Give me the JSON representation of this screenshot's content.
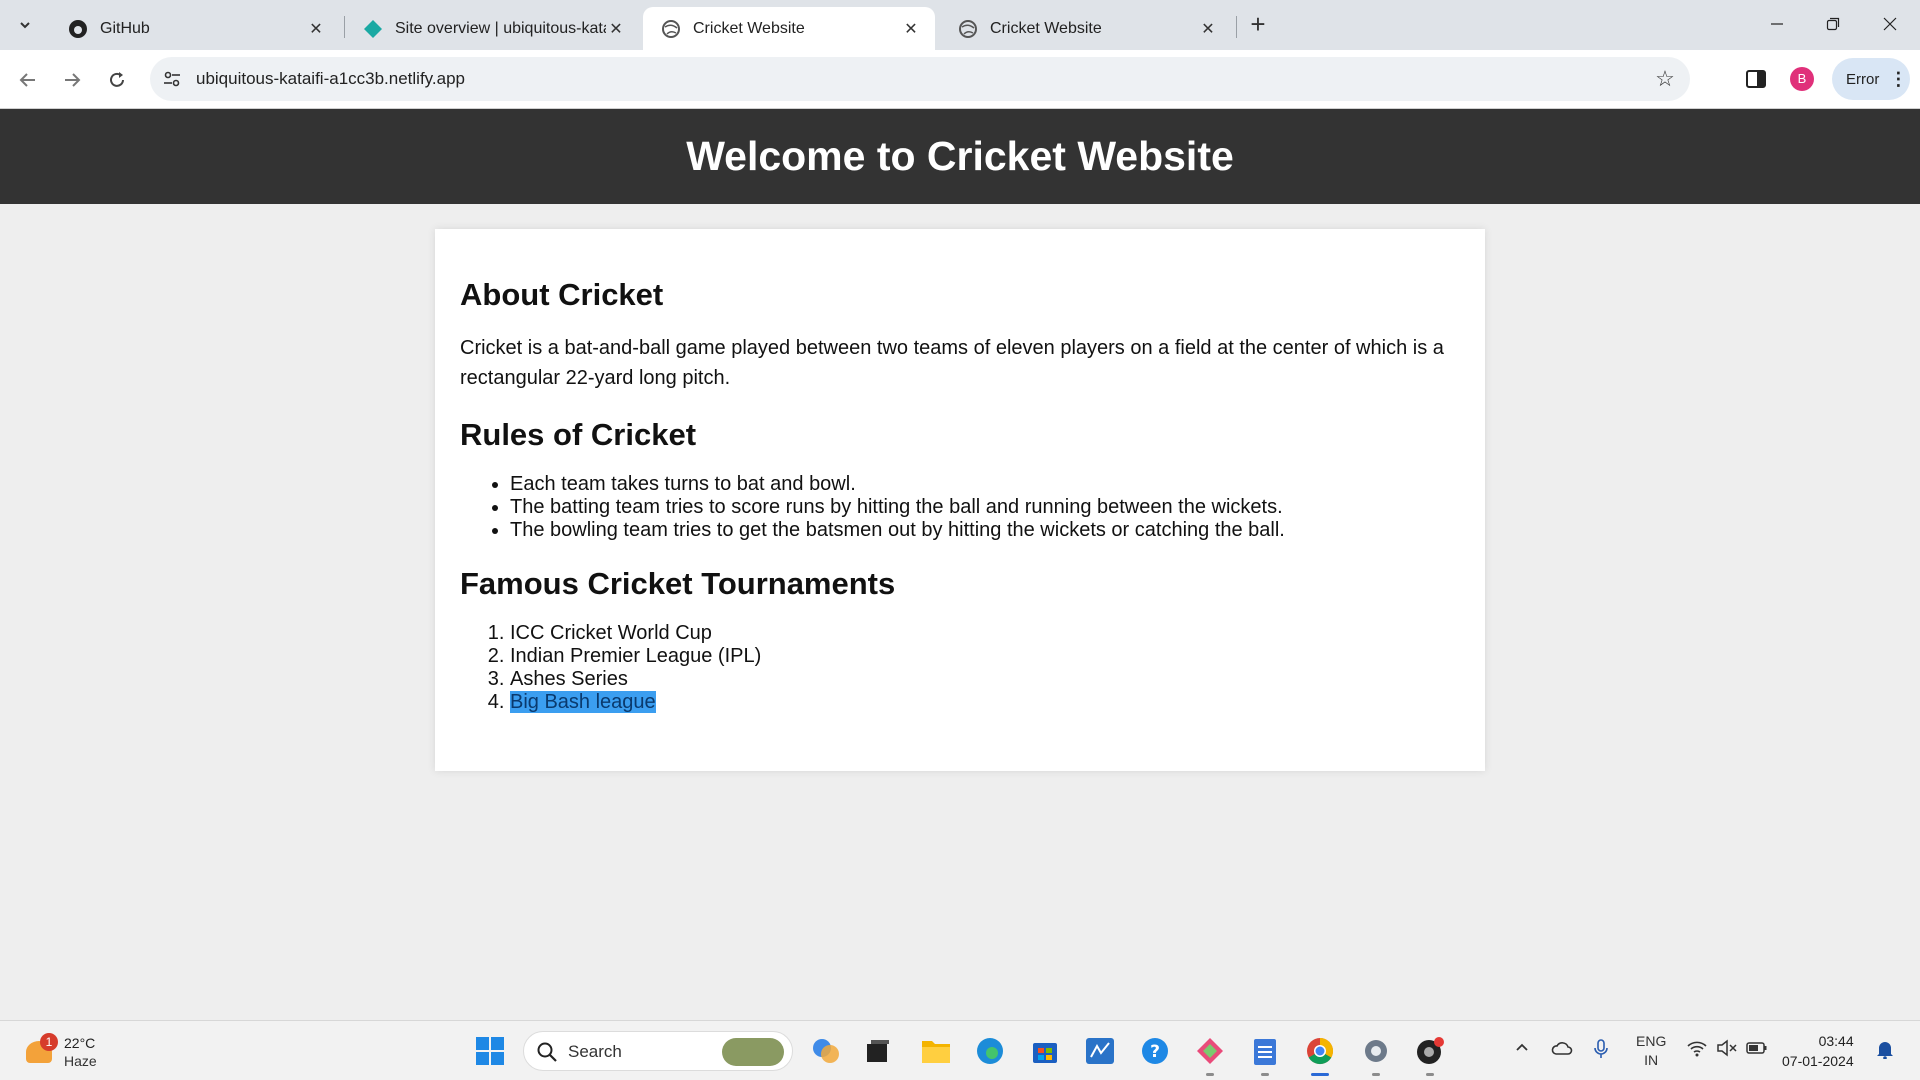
{
  "browser": {
    "tabs": [
      {
        "title": "GitHub",
        "icon": "github-icon"
      },
      {
        "title": "Site overview | ubiquitous-kataifi",
        "icon": "netlify-icon"
      },
      {
        "title": "Cricket Website",
        "icon": "globe-icon"
      },
      {
        "title": "Cricket Website",
        "icon": "globe-icon"
      }
    ],
    "url": "ubiquitous-kataifi-a1cc3b.netlify.app",
    "profile_initial": "B",
    "error_label": "Error"
  },
  "page": {
    "header_title": "Welcome to Cricket Website",
    "about": {
      "heading": "About Cricket",
      "text": "Cricket is a bat-and-ball game played between two teams of eleven players on a field at the center of which is a rectangular 22-yard long pitch."
    },
    "rules": {
      "heading": "Rules of Cricket",
      "items": [
        "Each team takes turns to bat and bowl.",
        "The batting team tries to score runs by hitting the ball and running between the wickets.",
        "The bowling team tries to get the batsmen out by hitting the wickets or catching the ball."
      ]
    },
    "tournaments": {
      "heading": "Famous Cricket Tournaments",
      "items": [
        "ICC Cricket World Cup",
        "Indian Premier League (IPL)",
        "Ashes Series",
        "Big Bash league"
      ]
    }
  },
  "taskbar": {
    "weather_badge": "1",
    "temperature": "22°C",
    "condition": "Haze",
    "search_label": "Search",
    "language_line1": "ENG",
    "language_line2": "IN",
    "time": "03:44",
    "date": "07-01-2024"
  },
  "colors": {
    "header_bg": "#333333",
    "selection_highlight": "#3b9ef0",
    "profile_avatar": "#e0307a"
  }
}
